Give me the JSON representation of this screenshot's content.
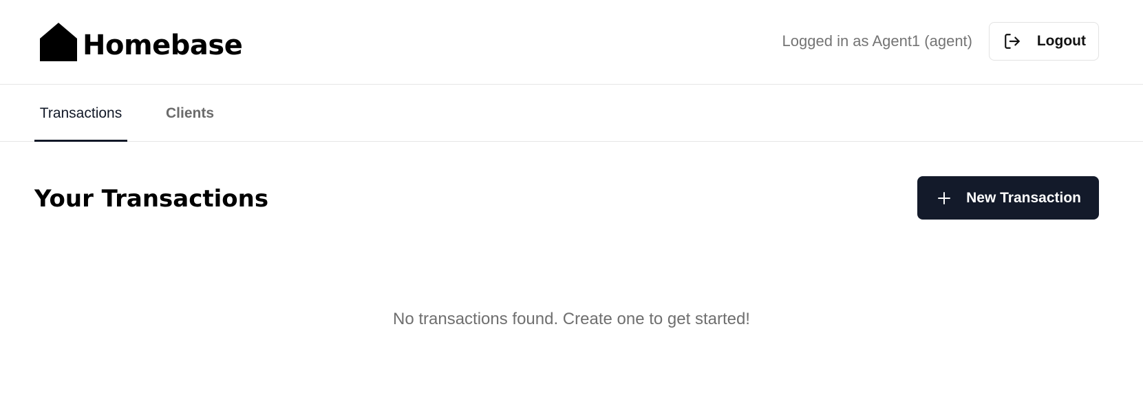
{
  "header": {
    "brand": "Homebase",
    "logo_icon": "house-icon",
    "user_text": "Logged in as Agent1 (agent)",
    "logout_label": "Logout",
    "logout_icon": "logout-icon"
  },
  "tabs": [
    {
      "label": "Transactions",
      "active": true
    },
    {
      "label": "Clients",
      "active": false
    }
  ],
  "main": {
    "title": "Your Transactions",
    "new_button_label": "New Transaction",
    "new_button_icon": "plus-icon",
    "empty_message": "No transactions found. Create one to get started!"
  },
  "colors": {
    "primary": "#131a2a",
    "muted_text": "#6f6f6f",
    "border": "#e6e6e6",
    "background": "#ffffff"
  }
}
